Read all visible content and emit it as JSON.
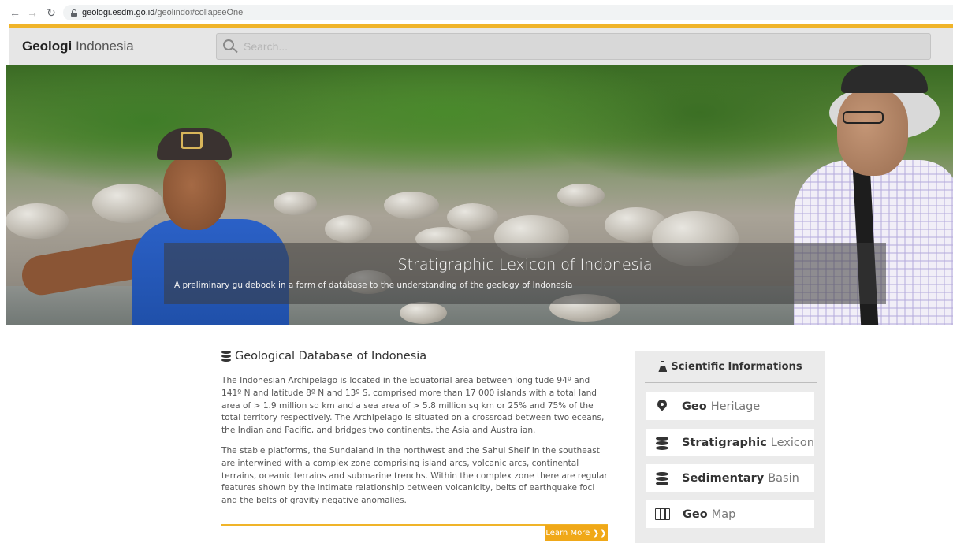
{
  "browser": {
    "url_domain": "geologi.esdm.go.id",
    "url_path": "/geolindo#collapseOne"
  },
  "header": {
    "logo_bold": "Geologi",
    "logo_light": "Indonesia",
    "search_placeholder": "Search..."
  },
  "hero": {
    "title": "Stratigraphic Lexicon of Indonesia",
    "subtitle": "A preliminary guidebook in a form of database to the understanding of the geology of Indonesia"
  },
  "main": {
    "heading": "Geological Database of Indonesia",
    "paragraphs": [
      "The Indonesian Archipelago is located in the Equatorial area between longitude 94º and 141º N and latitude 8º N and 13º S, comprised more than 17 000 islands with a total land area of > 1.9 million sq km and a sea area of > 5.8 million sq km or 25% and 75% of the total territory respectively. The Archipelago is situated on a crossroad between two eceans, the Indian and Pacific, and bridges two continents, the Asia and Australian.",
      "The stable platforms, the Sundaland in the northwest and the Sahul Shelf in the southeast are interwined with a complex zone comprising island arcs, volcanic arcs, continental terrains, oceanic terrains and submarine trenchs. Within the complex zone there are regular features shown by the intimate relationship between volcanicity, belts of earthquake foci and the belts of gravity negative anomalies."
    ],
    "learn_more_label": "Learn More",
    "learn_more_arrow": "❯❯"
  },
  "sidebar": {
    "title": "Scientific Informations",
    "items": [
      {
        "strong": "Geo",
        "light": "Heritage",
        "icon": "map-marker-icon"
      },
      {
        "strong": "Stratigraphic",
        "light": "Lexicon",
        "icon": "database-icon"
      },
      {
        "strong": "Sedimentary",
        "light": "Basin",
        "icon": "database-icon"
      },
      {
        "strong": "Geo",
        "light": "Map",
        "icon": "map-icon"
      }
    ]
  },
  "colors": {
    "accent": "#f0b429",
    "button": "#f0a818",
    "header_bg": "#e6e6e6"
  }
}
